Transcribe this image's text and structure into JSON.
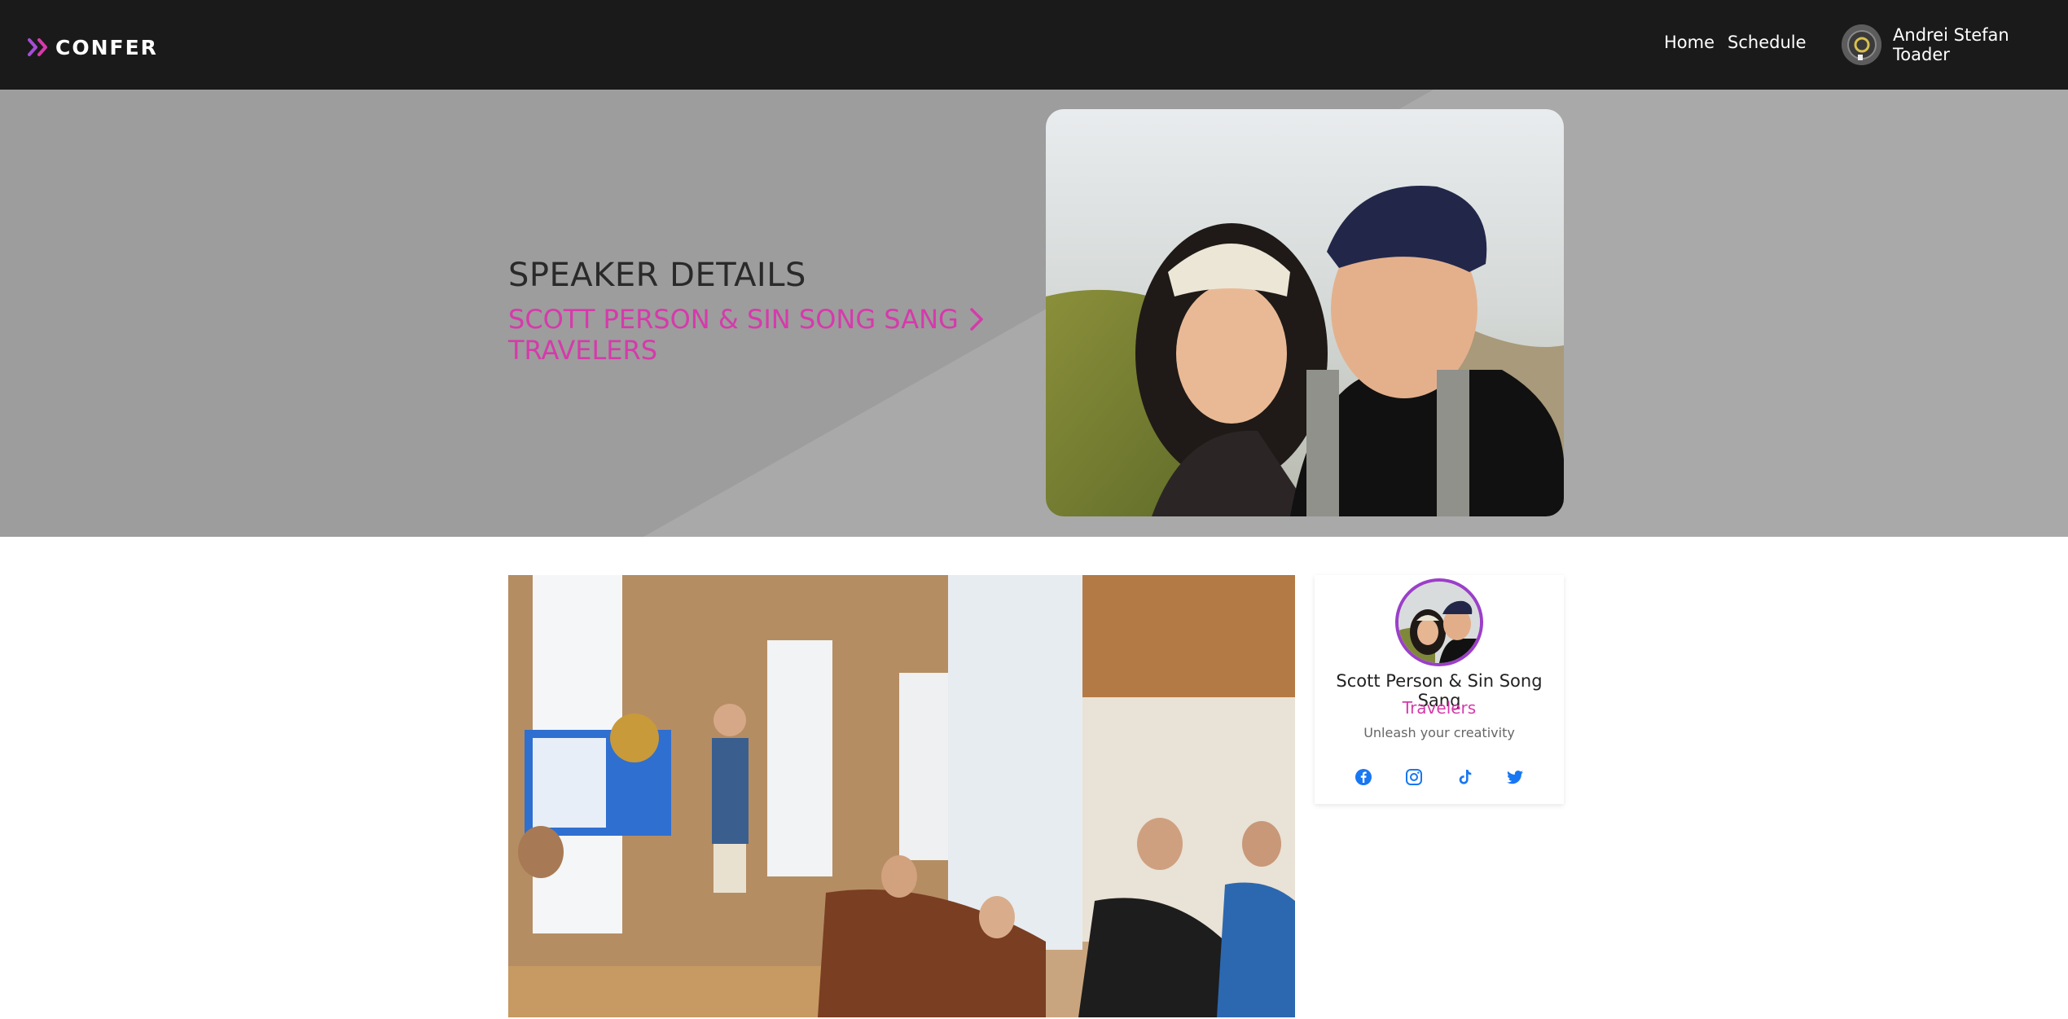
{
  "app": {
    "brand": "CONFER",
    "accent": "#d63aab",
    "brand_icon": "double-chevron-right-icon"
  },
  "nav": {
    "links": [
      "Home",
      "Schedule"
    ],
    "user": {
      "name": "Andrei Stefan Toader"
    }
  },
  "hero": {
    "heading": "SPEAKER DETAILS",
    "speaker_line": "SCOTT PERSON & SIN SONG SANG",
    "role_line": "TRAVELERS",
    "chevron_icon": "chevron-right-icon"
  },
  "profile_card": {
    "name": "Scott Person & Sin Song Sang",
    "role": "Travelers",
    "tagline": "Unleash your creativity",
    "social_icons": [
      "facebook-icon",
      "instagram-icon",
      "tiktok-icon",
      "twitter-icon"
    ],
    "social_color": "#1877f2"
  }
}
